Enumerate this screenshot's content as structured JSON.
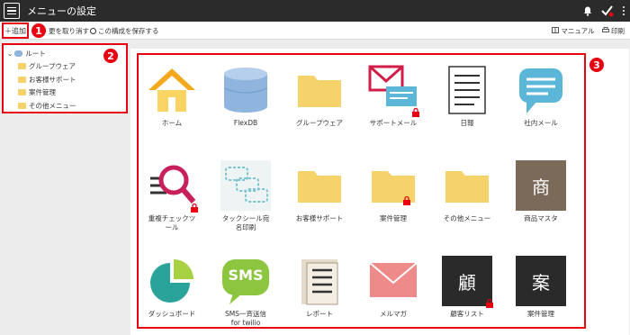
{
  "app": {
    "title": "メニューの設定"
  },
  "toolbar": {
    "add_label": "＋追加",
    "undo_label": "更を取り消す",
    "save_label": "この構成を保存する",
    "manual_label": "マニュアル",
    "print_label": "印刷"
  },
  "callouts": {
    "one": "1",
    "two": "2",
    "three": "3"
  },
  "tree": {
    "root": "ルート",
    "items": [
      "グループウェア",
      "お客様サポート",
      "案件管理",
      "その他メニュー"
    ]
  },
  "tiles": [
    {
      "label": "ホーム",
      "icon": "home-icon"
    },
    {
      "label": "FlexDB",
      "icon": "database-icon"
    },
    {
      "label": "グループウェア",
      "icon": "folder-icon"
    },
    {
      "label": "サポートメール",
      "icon": "mail-chat-icon"
    },
    {
      "label": "日報",
      "icon": "document-icon"
    },
    {
      "label": "社内メール",
      "icon": "chat-bubble-icon"
    },
    {
      "label": "重複チェックツ\nール",
      "icon": "magnifier-icon"
    },
    {
      "label": "タックシール宛\n名印刷",
      "icon": "label-print-icon"
    },
    {
      "label": "お客様サポート",
      "icon": "folder-icon"
    },
    {
      "label": "案件管理",
      "icon": "folder-icon"
    },
    {
      "label": "その他メニュー",
      "icon": "folder-icon"
    },
    {
      "label": "商品マスタ",
      "icon": "kanji-shou-icon",
      "kanji": "商"
    },
    {
      "label": "ダッシュボード",
      "icon": "pie-chart-icon"
    },
    {
      "label": "SMS一斉送信\nfor twilio",
      "icon": "sms-icon",
      "text": "SMS"
    },
    {
      "label": "レポート",
      "icon": "report-icon"
    },
    {
      "label": "メルマガ",
      "icon": "envelope-icon"
    },
    {
      "label": "顧客リスト",
      "icon": "kanji-ko-icon",
      "kanji": "顧"
    },
    {
      "label": "案件管理",
      "icon": "kanji-an-icon",
      "kanji": "案"
    }
  ],
  "colors": {
    "accent": "#e60012",
    "titlebar": "#2b2b2b",
    "folder": "#f5d36a"
  }
}
